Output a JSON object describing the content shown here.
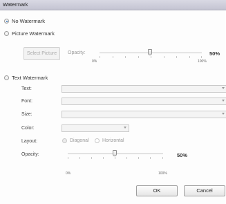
{
  "window": {
    "title": "Watermark"
  },
  "options": {
    "no_watermark": "No Watermark",
    "picture_watermark": "Picture Watermark",
    "text_watermark": "Text Watermark",
    "selected": "no_watermark"
  },
  "picture": {
    "select_button": "Select Picture",
    "opacity_label": "Opacity:",
    "opacity_value": "50%",
    "opacity_level": 0.5,
    "min_label": "0%",
    "max_label": "100%"
  },
  "text": {
    "text_label": "Text:",
    "font_label": "Font:",
    "size_label": "Size:",
    "color_label": "Color:",
    "layout_label": "Layout:",
    "layout_diagonal": "Diagonal",
    "layout_horizontal": "Horizontal",
    "opacity_label": "Opacity:",
    "opacity_value": "50%",
    "opacity_level": 0.5,
    "min_label": "0%",
    "max_label": "100%"
  },
  "buttons": {
    "ok": "OK",
    "cancel": "Cancel"
  }
}
